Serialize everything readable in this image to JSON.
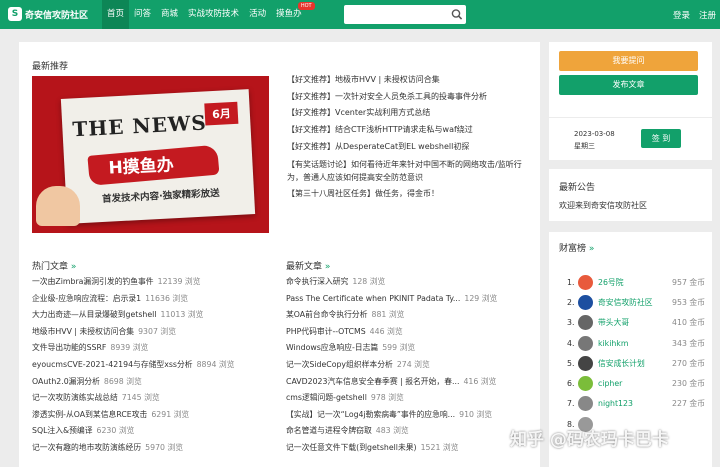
{
  "header": {
    "logo_icon": "S",
    "logo_text": "奇安信攻防社区",
    "nav": [
      {
        "label": "首页",
        "active": true
      },
      {
        "label": "问答"
      },
      {
        "label": "商城"
      },
      {
        "label": "实战攻防技术"
      },
      {
        "label": "活动"
      },
      {
        "label": "摸鱼办",
        "badge": "HOT"
      }
    ],
    "search_placeholder": "",
    "login": "登录",
    "register": "注册"
  },
  "recommend": {
    "title": "最新推荐",
    "banner": {
      "headline": "THE NEWS",
      "badge": "6月",
      "brand": "H摸鱼办",
      "subtitle": "首发技术内容·独家精彩放送"
    },
    "items": [
      "【好文推荐】地极市HVV | 未授权访问合集",
      "【好文推荐】一次针对安全人员免杀工具的投毒事件分析",
      "【好文推荐】Vcenter实战利用方式总结",
      "【好文推荐】结合CTF浅析HTTP请求走私与waf绕过",
      "【好文推荐】从DesperateCat到EL webshell初探",
      "【有奖话题讨论】如何看待近年来针对中国不断的网络攻击/监听行为，普通人应该如何提高安全防范意识",
      "【第三十八周社区任务】做任务，得金币！"
    ]
  },
  "hot_articles": {
    "title": "热门文章",
    "more": "»",
    "items": [
      {
        "title": "一次由Zimbra漏洞引发的钓鱼事件",
        "views": "12139 浏览"
      },
      {
        "title": "企业级-应急响应流程：启示录1",
        "views": "11636 浏览"
      },
      {
        "title": "大力出奇迹—从目录爆破到getshell",
        "views": "11013 浏览"
      },
      {
        "title": "地级市HVV | 未授权访问合集",
        "views": "9307 浏览"
      },
      {
        "title": "文件导出功能的SSRF",
        "views": "8939 浏览"
      },
      {
        "title": "eyoucmsCVE-2021-42194与存储型xss分析",
        "views": "8894 浏览"
      },
      {
        "title": "OAuth2.0漏洞分析",
        "views": "8698 浏览"
      },
      {
        "title": "记一次攻防演练实战总结",
        "views": "7145 浏览"
      },
      {
        "title": "渗透实例-从OA到某信息RCE攻击",
        "views": "6291 浏览"
      },
      {
        "title": "SQL注入&预编译",
        "views": "6230 浏览"
      },
      {
        "title": "记一次有趣的地市攻防演练经历",
        "views": "5970 浏览"
      }
    ]
  },
  "latest_articles": {
    "title": "最新文章",
    "more": "»",
    "items": [
      {
        "title": "命令执行深入研究",
        "views": "128 浏览"
      },
      {
        "title": "Pass The Certificate when PKINIT Padata Ty...",
        "views": "129 浏览"
      },
      {
        "title": "某OA前台命令执行分析",
        "views": "881 浏览"
      },
      {
        "title": "PHP代码审计--OTCMS",
        "views": "446 浏览"
      },
      {
        "title": "Windows应急响应-日志篇",
        "views": "599 浏览"
      },
      {
        "title": "记一次SideCopy组织样本分析",
        "views": "274 浏览"
      },
      {
        "title": "CAVD2023汽车信息安全春季赛 | 报名开始，春...",
        "views": "416 浏览"
      },
      {
        "title": "cms逻辑问题-getshell",
        "views": "978 浏览"
      },
      {
        "title": "【实战】记一次“Log4j勒索病毒”事件的应急响...",
        "views": "910 浏览"
      },
      {
        "title": "命名管道与进程令牌窃取",
        "views": "483 浏览"
      },
      {
        "title": "记一次任意文件下载(到getshell未果)",
        "views": "1521 浏览"
      }
    ]
  },
  "sidebar": {
    "ask_button": "我要提问",
    "post_button": "发布文章",
    "date": "2023-03-08",
    "weekday": "星期三",
    "sign_button": "签 到",
    "notice_title": "最新公告",
    "notice_text": "欢迎来到奇安信攻防社区",
    "rich_title": "财富榜",
    "rich_more": "»",
    "rich": [
      {
        "rank": "1.",
        "name": "26号院",
        "gold": "957 金币",
        "color": "#e85a3c"
      },
      {
        "rank": "2.",
        "name": "奇安信攻防社区",
        "gold": "953 金币",
        "color": "#1d4fa0"
      },
      {
        "rank": "3.",
        "name": "带头大哥",
        "gold": "410 金币",
        "color": "#666666"
      },
      {
        "rank": "4.",
        "name": "kikihkm",
        "gold": "343 金币",
        "color": "#777777"
      },
      {
        "rank": "5.",
        "name": "信安成长计划",
        "gold": "270 金币",
        "color": "#444444"
      },
      {
        "rank": "6.",
        "name": "cipher",
        "gold": "230 金币",
        "color": "#7bbd3a"
      },
      {
        "rank": "7.",
        "name": "night123",
        "gold": "227 金币",
        "color": "#888888"
      },
      {
        "rank": "8.",
        "name": "",
        "gold": "",
        "color": "#999999"
      }
    ]
  },
  "watermark": "知乎 @码农玛卡巴卡",
  "colors": {
    "brand": "#12a06a",
    "orange": "#efa43b",
    "banner_red": "#b6141a"
  }
}
